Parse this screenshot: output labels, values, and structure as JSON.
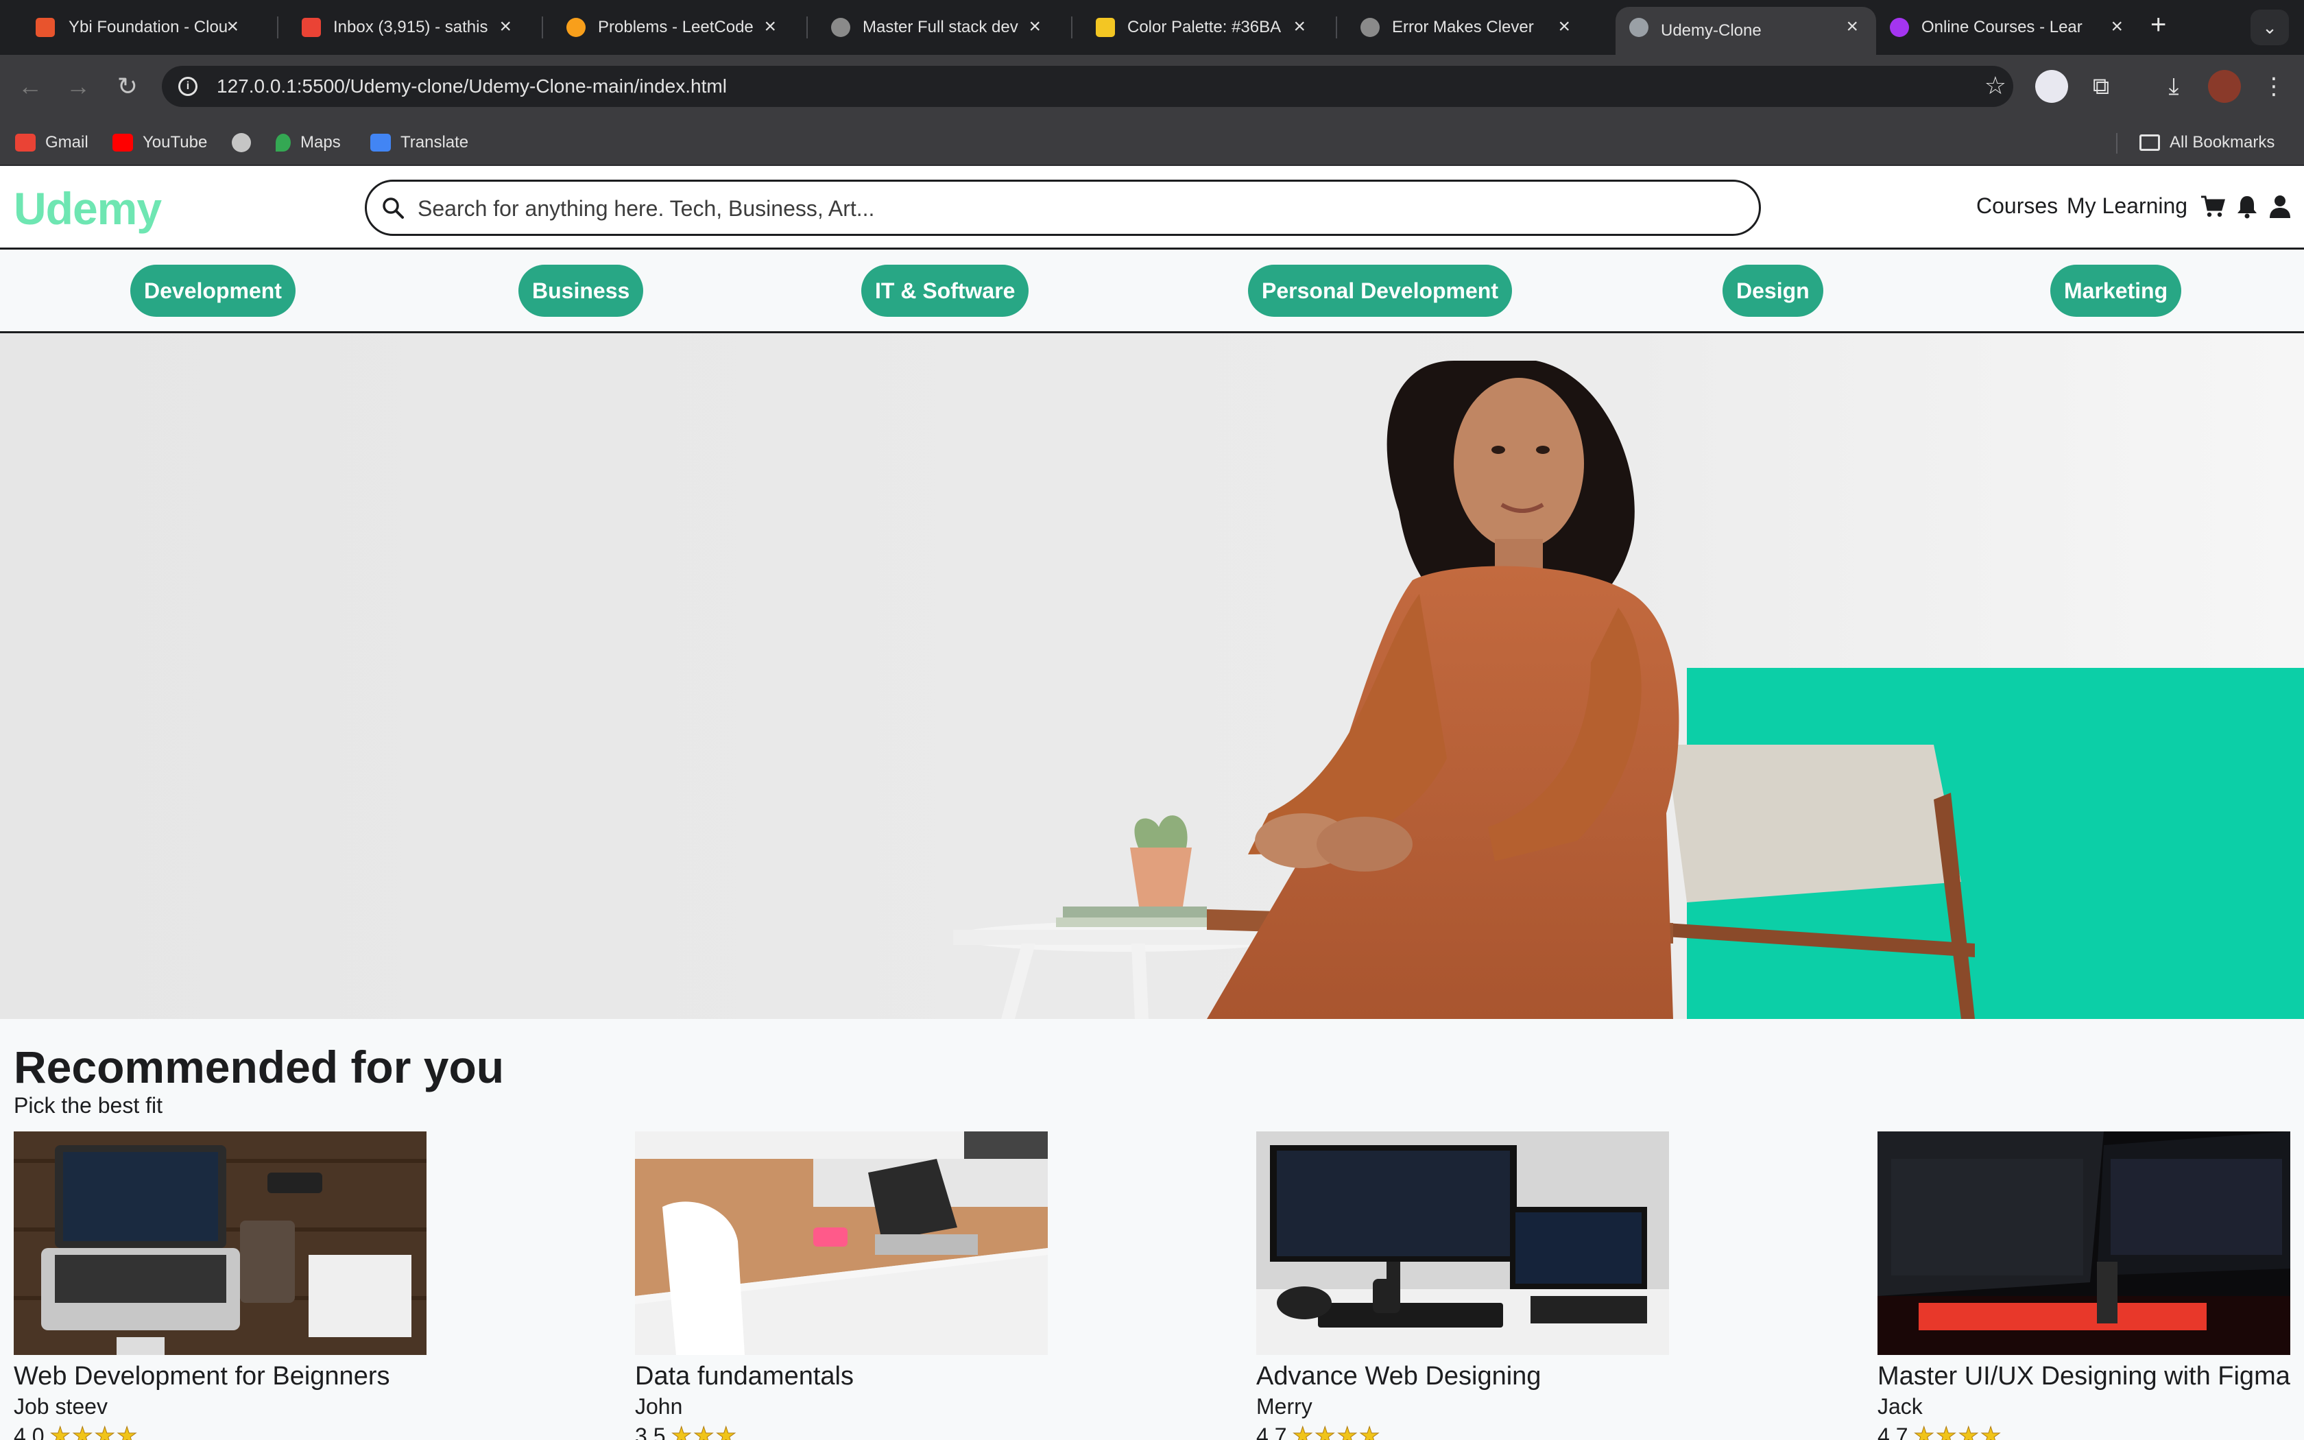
{
  "browser": {
    "tabs": [
      {
        "title": "Ybi Foundation - Clou",
        "favicon_color": "#e8542d"
      },
      {
        "title": "Inbox (3,915) - sathis",
        "favicon_color": "#ea4335"
      },
      {
        "title": "Problems - LeetCode",
        "favicon_color": "#f89f1b"
      },
      {
        "title": "Master Full stack dev",
        "favicon_color": "#8a8a8a"
      },
      {
        "title": "Color Palette: #36BA",
        "favicon_color": "#f3c623"
      },
      {
        "title": "Error Makes Clever",
        "favicon_color": "#8a8a8a"
      },
      {
        "title": "Udemy-Clone",
        "favicon_color": "#9aa0a6"
      },
      {
        "title": "Online Courses - Lear",
        "favicon_color": "#a435f0"
      }
    ],
    "active_tab_index": 6,
    "url": "127.0.0.1:5500/Udemy-clone/Udemy-Clone-main/index.html",
    "bookmarks": [
      {
        "label": "Gmail",
        "icon": "gmail-icon",
        "color": "#ea4335"
      },
      {
        "label": "YouTube",
        "icon": "youtube-icon",
        "color": "#ff0000"
      },
      {
        "label": "",
        "icon": "globe-icon",
        "color": "#c5c5c5"
      },
      {
        "label": "Maps",
        "icon": "maps-icon",
        "color": "#34a853"
      },
      {
        "label": "Translate",
        "icon": "translate-icon",
        "color": "#4285f4"
      }
    ],
    "all_bookmarks_label": "All Bookmarks"
  },
  "site": {
    "logo": "Udemy",
    "search_placeholder": "Search for anything here. Tech, Business, Art...",
    "nav": {
      "courses": "Courses",
      "my_learning": "My Learning"
    },
    "categories": [
      "Development",
      "Business",
      "IT & Software",
      "Personal Development",
      "Design",
      "Marketing"
    ],
    "accent_color": "#28a785",
    "logo_color": "#6ee6b2"
  },
  "recommended": {
    "title": "Recommended for you",
    "subtitle": "Pick the best fit",
    "courses": [
      {
        "title": "Web Development for Beignners",
        "author": "Job steev",
        "rating": "4.0",
        "stars": 4
      },
      {
        "title": "Data fundamentals",
        "author": "John",
        "rating": "3.5",
        "stars": 3
      },
      {
        "title": "Advance Web Designing",
        "author": "Merry",
        "rating": "4.7",
        "stars": 4
      },
      {
        "title": "Master UI/UX Designing with Figma",
        "author": "Jack",
        "rating": "4.7",
        "stars": 4
      }
    ]
  }
}
